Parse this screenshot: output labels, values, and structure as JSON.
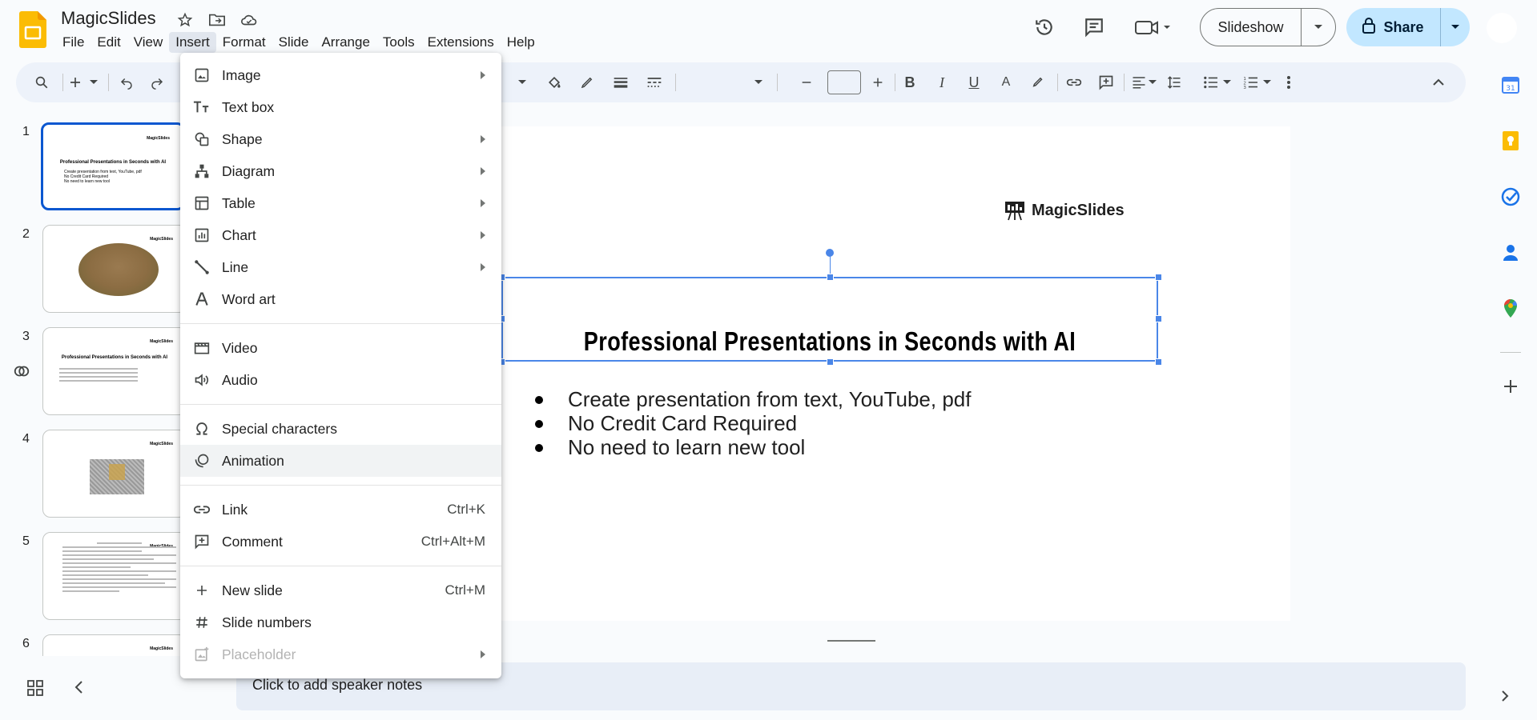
{
  "app": {
    "title": "MagicSlides",
    "brand_color": "#fbbc04"
  },
  "menubar": [
    "File",
    "Edit",
    "View",
    "Insert",
    "Format",
    "Slide",
    "Arrange",
    "Tools",
    "Extensions",
    "Help"
  ],
  "menubar_active": "Insert",
  "header": {
    "slideshow_label": "Slideshow",
    "share_label": "Share"
  },
  "insert_menu": {
    "groups": [
      [
        {
          "label": "Image",
          "icon": "image-icon",
          "submenu": true
        },
        {
          "label": "Text box",
          "icon": "text-box-icon",
          "submenu": false
        },
        {
          "label": "Shape",
          "icon": "shape-icon",
          "submenu": true
        },
        {
          "label": "Diagram",
          "icon": "diagram-icon",
          "submenu": true
        },
        {
          "label": "Table",
          "icon": "table-icon",
          "submenu": true
        },
        {
          "label": "Chart",
          "icon": "chart-icon",
          "submenu": true
        },
        {
          "label": "Line",
          "icon": "line-icon",
          "submenu": true
        },
        {
          "label": "Word art",
          "icon": "word-art-icon",
          "submenu": false
        }
      ],
      [
        {
          "label": "Video",
          "icon": "video-icon",
          "submenu": false
        },
        {
          "label": "Audio",
          "icon": "audio-icon",
          "submenu": false
        }
      ],
      [
        {
          "label": "Special characters",
          "icon": "omega-icon",
          "submenu": false
        },
        {
          "label": "Animation",
          "icon": "animation-icon",
          "submenu": false
        }
      ],
      [
        {
          "label": "Link",
          "icon": "link-icon",
          "shortcut": "Ctrl+K"
        },
        {
          "label": "Comment",
          "icon": "comment-add-icon",
          "shortcut": "Ctrl+Alt+M"
        }
      ],
      [
        {
          "label": "New slide",
          "icon": "plus-icon",
          "shortcut": "Ctrl+M"
        },
        {
          "label": "Slide numbers",
          "icon": "hash-icon"
        },
        {
          "label": "Placeholder",
          "icon": "placeholder-icon",
          "submenu": true,
          "disabled": true
        }
      ]
    ],
    "hovered": "Animation"
  },
  "slides": {
    "numbers": [
      "1",
      "2",
      "3",
      "4",
      "5",
      "6"
    ],
    "selected": 1,
    "thumb_logo": "MagicSlides",
    "thumb1_title": "Professional Presentations in Seconds with AI",
    "thumb1_bullets": [
      "Create presentation from text, YouTube, pdf",
      "No Credit Card Required",
      "No need to learn new tool"
    ],
    "thumb3_title": "Professional Presentations in Seconds with AI"
  },
  "current_slide": {
    "brand": "MagicSlides",
    "title": "Professional Presentations in Seconds with AI",
    "bullets": [
      "Create presentation from text, YouTube, pdf",
      "No Credit Card Required",
      "No need to learn new tool"
    ]
  },
  "notes": {
    "placeholder": "Click to add speaker notes"
  }
}
